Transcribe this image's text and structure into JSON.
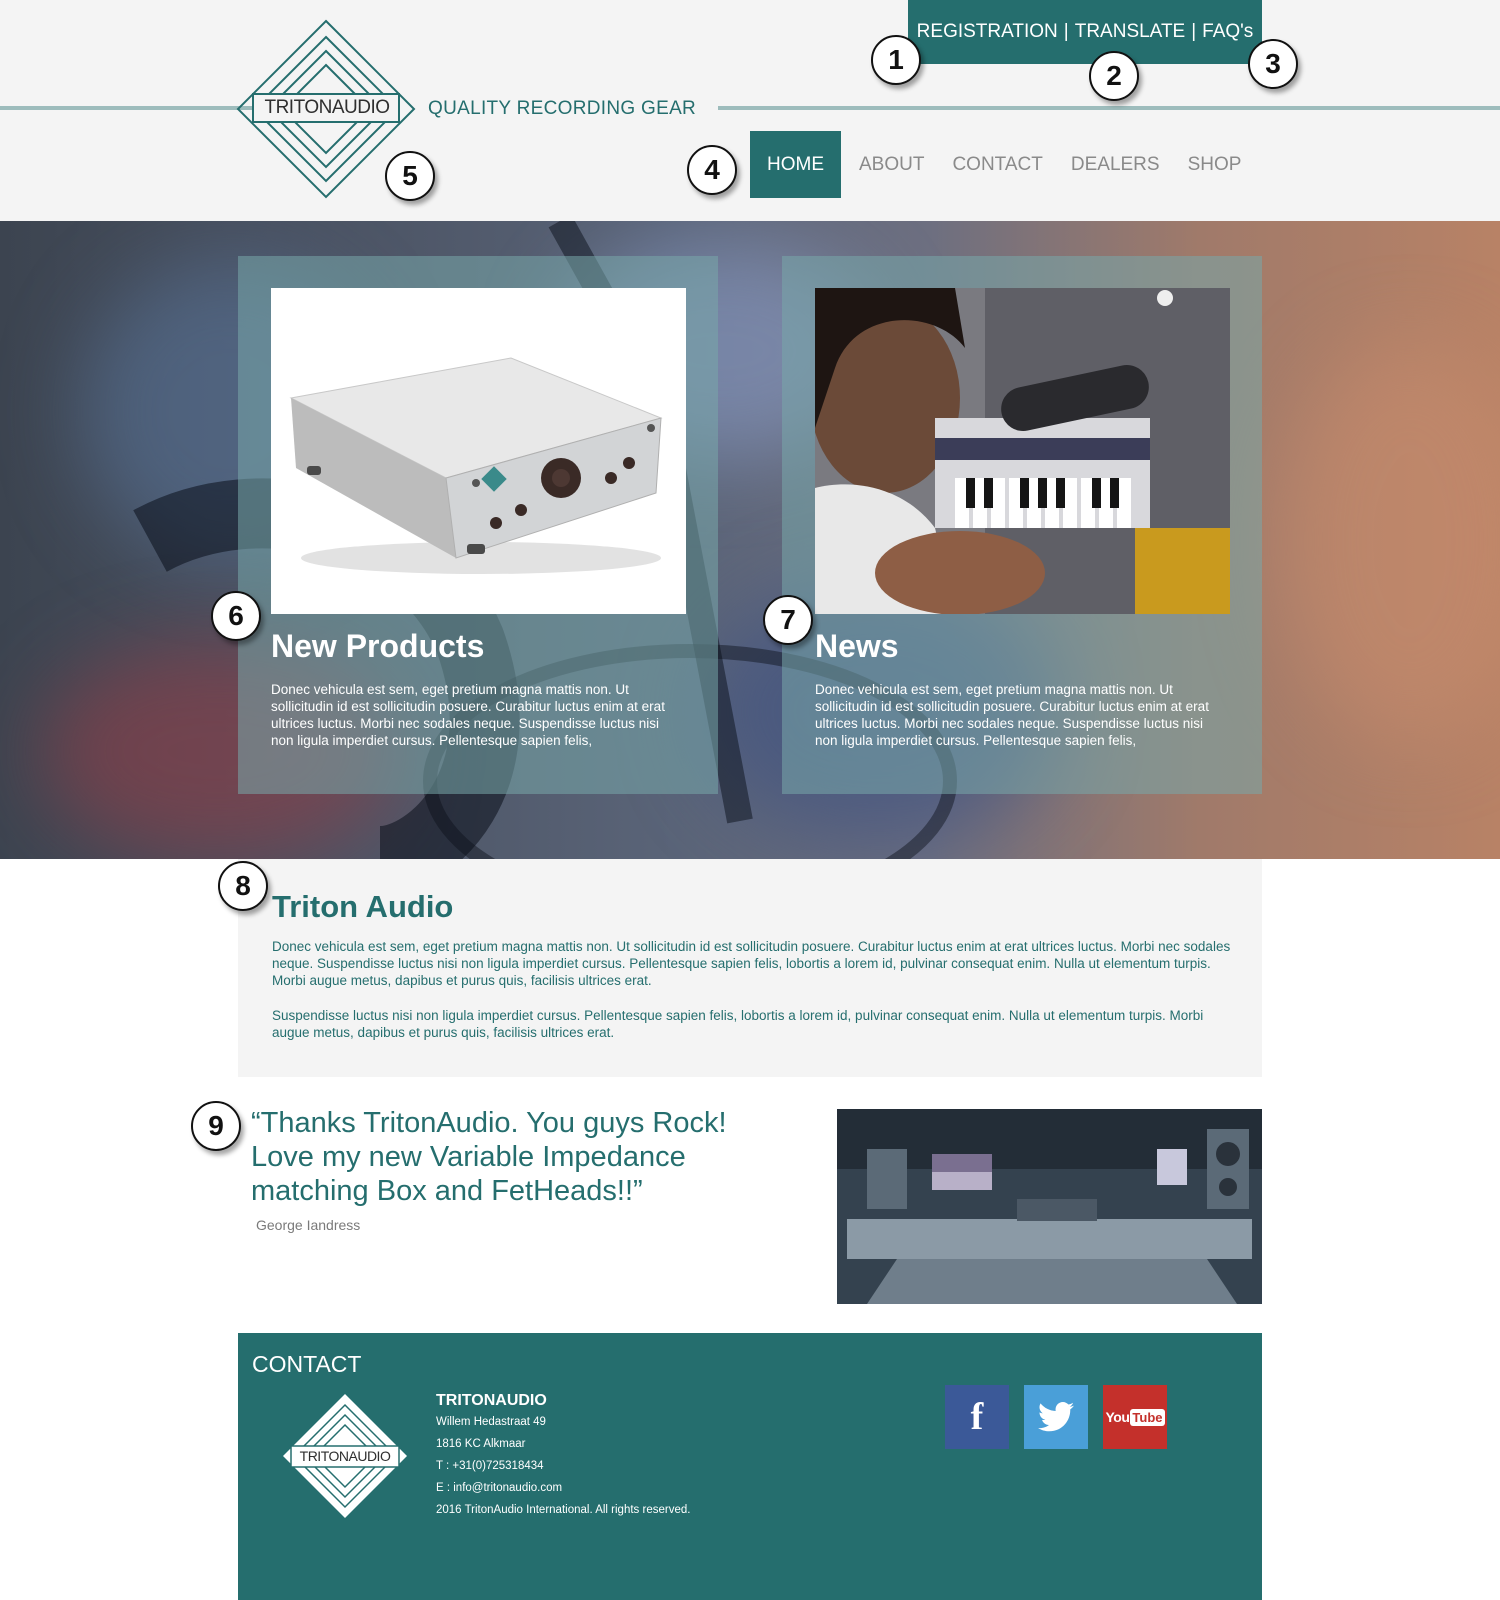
{
  "header": {
    "logo_text": "TRITONAUDIO",
    "tagline": "QUALITY RECORDING GEAR",
    "utility_links": [
      "REGISTRATION",
      "TRANSLATE",
      "FAQ's"
    ],
    "utility_separator": "|",
    "nav": [
      "HOME",
      "ABOUT",
      "CONTACT",
      "DEALERS",
      "SHOP"
    ],
    "active_nav": "HOME"
  },
  "markers": [
    "1",
    "2",
    "3",
    "4",
    "5",
    "6",
    "7",
    "8",
    "9"
  ],
  "cards": [
    {
      "title": "New Products",
      "text": "Donec vehicula est sem, eget pretium magna mattis non. Ut sollicitudin id est sollicitudin posuere. Curabitur luctus enim at erat ultrices luctus. Morbi nec sodales neque. Suspendisse luctus nisi non ligula imperdiet cursus. Pellentesque sapien felis,",
      "image": "preamp-product-photo"
    },
    {
      "title": "News",
      "text": "Donec vehicula est sem, eget pretium magna mattis non. Ut sollicitudin id est sollicitudin posuere. Curabitur luctus enim at erat ultrices luctus. Morbi nec sodales neque. Suspendisse luctus nisi non ligula imperdiet cursus. Pellentesque sapien felis,",
      "image": "artist-studio-photo"
    }
  ],
  "about": {
    "title": "Triton Audio",
    "paragraphs": [
      "Donec vehicula est sem, eget pretium magna mattis non. Ut sollicitudin id est sollicitudin posuere. Curabitur luctus enim at erat ultrices luctus. Morbi nec sodales neque. Suspendisse luctus nisi non ligula imperdiet cursus. Pellentesque sapien felis, lobortis a lorem id, pulvinar consequat enim. Nulla ut elementum turpis. Morbi augue metus, dapibus et purus quis, facilisis ultrices erat.",
      "Suspendisse luctus nisi non ligula imperdiet cursus. Pellentesque sapien felis, lobortis a lorem id, pulvinar consequat enim. Nulla ut elementum turpis. Morbi augue metus, dapibus et purus quis, facilisis ultrices erat."
    ]
  },
  "testimonial": {
    "quote": "“Thanks TritonAudio. You guys Rock! Love my new Variable Impedance matching Box and FetHeads!!”",
    "author": "George Iandress"
  },
  "footer": {
    "title": "CONTACT",
    "logo_text": "TRITONAUDIO",
    "company": "TRITONAUDIO",
    "lines": [
      "Willem Hedastraat 49",
      "1816 KC Alkmaar",
      "T : +31(0)725318434",
      "E : info@tritonaudio.com",
      "2016 TritonAudio International. All rights reserved."
    ],
    "social": [
      {
        "name": "facebook",
        "glyph": "f",
        "color": "#3b5998"
      },
      {
        "name": "twitter",
        "glyph": "twitter-bird",
        "color": "#4a9fd8"
      },
      {
        "name": "youtube",
        "glyph": "You",
        "glyph2": "Tube",
        "color": "#c4302b"
      }
    ]
  },
  "colors": {
    "brand_teal": "#256e6e",
    "header_bg": "#f4f4f4",
    "rule": "#9dbcbc",
    "muted_text": "#8a8a8a"
  }
}
